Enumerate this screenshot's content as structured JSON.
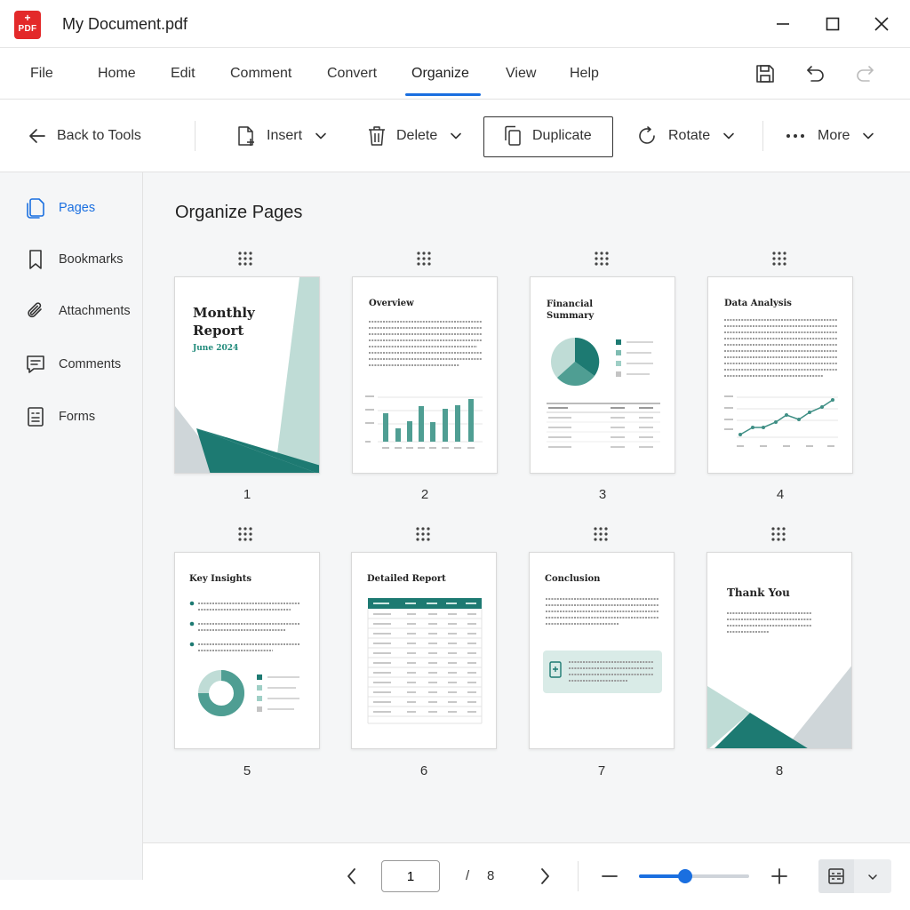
{
  "window": {
    "title": "My Document.pdf",
    "logo_plus": "+",
    "logo_text": "PDF",
    "controls": [
      "minimize",
      "maximize",
      "close"
    ]
  },
  "menu": {
    "items": [
      "File",
      "Home",
      "Edit",
      "Comment",
      "Convert",
      "Organize",
      "View",
      "Help"
    ],
    "active": "Organize",
    "accent": "#1a6fe0"
  },
  "toolbar": {
    "back": "Back to Tools",
    "insert": "Insert",
    "delete": "Delete",
    "duplicate": "Duplicate",
    "rotate": "Rotate",
    "more": "More"
  },
  "sidebar": {
    "items": [
      {
        "label": "Pages",
        "icon": "pages-icon"
      },
      {
        "label": "Bookmarks",
        "icon": "bookmark-icon"
      },
      {
        "label": "Attachments",
        "icon": "paperclip-icon"
      },
      {
        "label": "Comments",
        "icon": "comment-icon"
      },
      {
        "label": "Forms",
        "icon": "form-icon"
      }
    ],
    "active": "Pages"
  },
  "main": {
    "title": "Organize Pages",
    "pages": [
      {
        "num": "1",
        "title": "Monthly Report",
        "subtitle": "June 2024"
      },
      {
        "num": "2",
        "title": "Overview"
      },
      {
        "num": "3",
        "title": "Financial Summary"
      },
      {
        "num": "4",
        "title": "Data Analysis"
      },
      {
        "num": "5",
        "title": "Key Insights"
      },
      {
        "num": "6",
        "title": "Detailed Report"
      },
      {
        "num": "7",
        "title": "Conclusion"
      },
      {
        "num": "8",
        "title": "Thank You"
      }
    ]
  },
  "bottom": {
    "current_page": "1",
    "separator": "/",
    "total_pages": "8",
    "zoom_fraction": 0.42
  },
  "colors": {
    "teal_dark": "#1d7a72",
    "teal_light": "#bfdcd6",
    "grey_shape": "#cfd6d9"
  }
}
